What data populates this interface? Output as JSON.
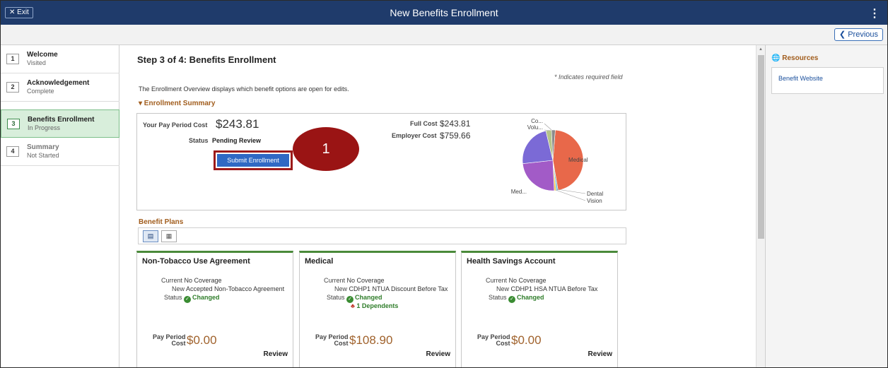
{
  "topbar": {
    "exit_label": "✕ Exit",
    "title": "New Benefits Enrollment",
    "menu_glyph": "⋮"
  },
  "secbar": {
    "previous_label": "❮ Previous"
  },
  "steps": [
    {
      "num": "1",
      "name": "Welcome",
      "status": "Visited"
    },
    {
      "num": "2",
      "name": "Acknowledgement",
      "status": "Complete"
    },
    {
      "num": "3",
      "name": "Benefits Enrollment",
      "status": "In Progress"
    },
    {
      "num": "4",
      "name": "Summary",
      "status": "Not Started"
    }
  ],
  "main": {
    "step_title": "Step 3 of 4: Benefits Enrollment",
    "required_note": "* Indicates required field",
    "overview_text": "The Enrollment Overview displays which benefit options are open for edits.",
    "enrollment_summary_label": "▾ Enrollment Summary",
    "summary": {
      "pay_period_cost_label": "Your Pay Period Cost",
      "pay_period_cost_value": "$243.81",
      "status_label": "Status",
      "status_value": "Pending Review",
      "full_cost_label": "Full Cost",
      "full_cost_value": "$243.81",
      "employer_cost_label": "Employer Cost",
      "employer_cost_value": "$759.66",
      "submit_label": "Submit Enrollment"
    },
    "callout_number": "1",
    "benefit_plans_label": "Benefit Plans",
    "toggle_icons": [
      "tile-view-icon",
      "grid-view-icon"
    ],
    "cards": [
      {
        "title": "Non-Tobacco Use Agreement",
        "current_label": "Current",
        "current_value": "No Coverage",
        "new_label": "New",
        "new_value": "Accepted Non-Tobacco Agreement",
        "status_label": "Status",
        "status_value": "Changed",
        "dependents": "",
        "pay_period_label_1": "Pay Period",
        "pay_period_label_2": "Cost",
        "pay_period_value": "$0.00",
        "review_label": "Review"
      },
      {
        "title": "Medical",
        "current_label": "Current",
        "current_value": "No Coverage",
        "new_label": "New",
        "new_value": "CDHP1 NTUA Discount Before Tax",
        "status_label": "Status",
        "status_value": "Changed",
        "dependents": "1 Dependents",
        "pay_period_label_1": "Pay Period",
        "pay_period_label_2": "Cost",
        "pay_period_value": "$108.90",
        "review_label": "Review"
      },
      {
        "title": "Health Savings Account",
        "current_label": "Current",
        "current_value": "No Coverage",
        "new_label": "New",
        "new_value": "CDHP1 HSA NTUA Before Tax",
        "status_label": "Status",
        "status_value": "Changed",
        "dependents": "",
        "pay_period_label_1": "Pay Period",
        "pay_period_label_2": "Cost",
        "pay_period_value": "$0.00",
        "review_label": "Review"
      }
    ]
  },
  "chart_data": {
    "type": "pie",
    "title": "",
    "slices": [
      {
        "label": "Medical",
        "value": 46,
        "color": "#e8684a"
      },
      {
        "label": "Dental",
        "value": 1,
        "color": "#6fc3df"
      },
      {
        "label": "Vision",
        "value": 1,
        "color": "#f2c94c"
      },
      {
        "label": "Med...",
        "value": 24,
        "color": "#a25bc7"
      },
      {
        "label": "",
        "value": 23,
        "color": "#7b6ad6"
      },
      {
        "label": "Co...",
        "value": 3,
        "color": "#b5c48a"
      },
      {
        "label": "Volu...",
        "value": 2,
        "color": "#8b8b8b"
      }
    ]
  },
  "resources": {
    "heading": "Resources",
    "link": "Benefit Website"
  },
  "colors": {
    "header_bg": "#1f3b6b",
    "accent_orange": "#a15d1d",
    "active_step_bg": "#d8eedb",
    "submit_blue": "#2f69c4",
    "callout_red": "#9a1414"
  }
}
